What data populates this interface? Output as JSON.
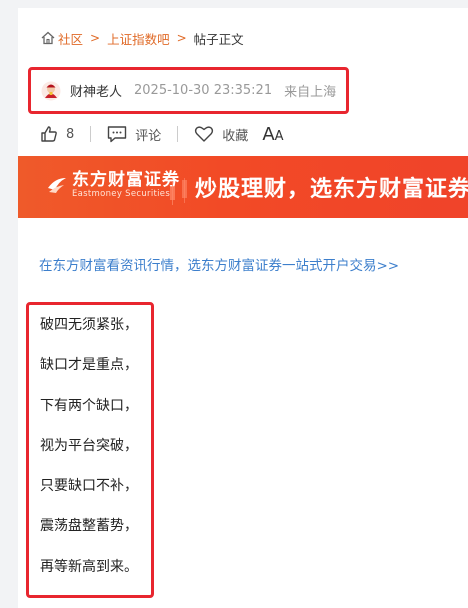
{
  "breadcrumb": {
    "items": [
      "社区",
      "上证指数吧"
    ],
    "separator": ">",
    "current": "帖子正文"
  },
  "author": {
    "name": "财神老人",
    "time": "2025-10-30 23:35:21",
    "from": "来自上海"
  },
  "actions": {
    "like_count": "8",
    "comment_label": "评论",
    "favorite_label": "收藏",
    "font_big": "A",
    "font_small": "A"
  },
  "banner": {
    "brand": "东方财富证券",
    "brand_en": "Eastmoney Securities",
    "slogan": "炒股理财，选东方财富证券"
  },
  "promo_link": "在东方财富看资讯行情，选东方财富证券一站式开户交易>>",
  "post_lines": [
    "破四无须紧张，",
    "缺口才是重点，",
    "下有两个缺口，",
    "视为平台突破，",
    "只要缺口不补，",
    "震荡盘整蓄势，",
    "再等新高到来。"
  ],
  "colors": {
    "accent_orange": "#e06a27",
    "highlight_red": "#e8262f",
    "link_blue": "#3d7fcc",
    "banner_red": "#f24a26"
  }
}
